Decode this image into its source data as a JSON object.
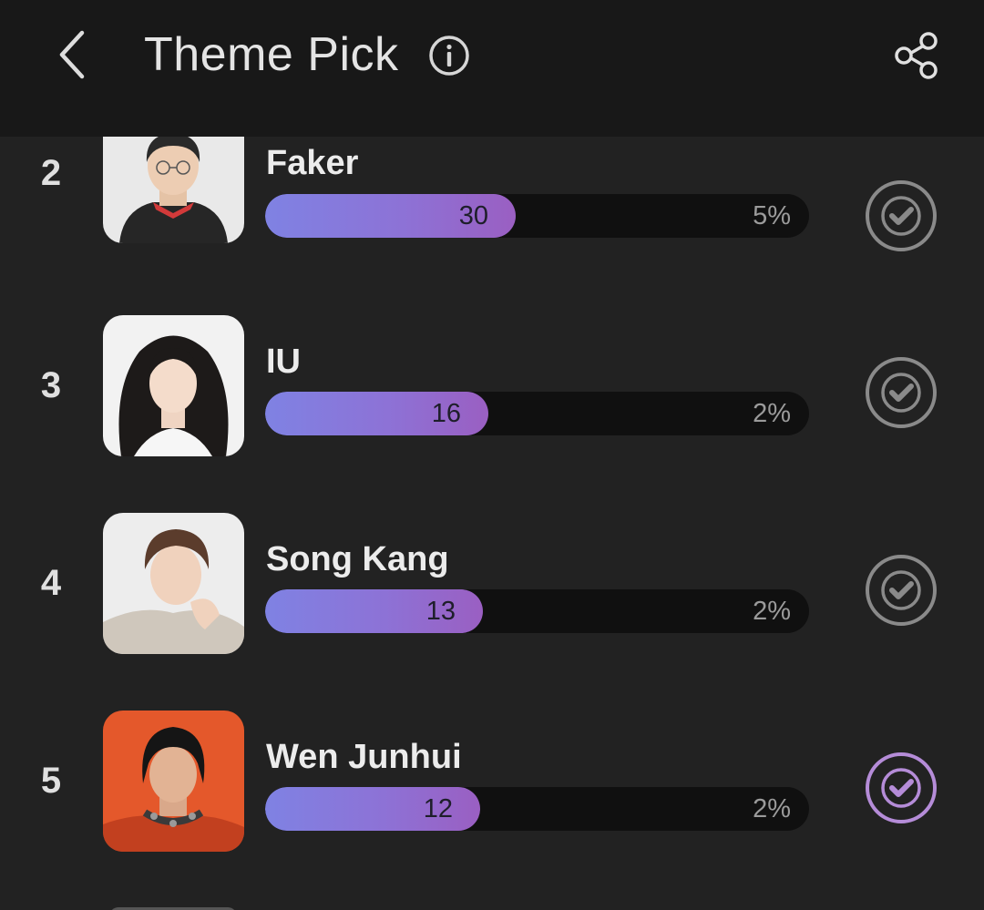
{
  "header": {
    "title": "Theme Pick"
  },
  "icons": {
    "back": "chevron-left-icon",
    "info": "info-icon",
    "share": "share-icon",
    "vote": "check-circle-icon"
  },
  "colors": {
    "background": "#222222",
    "header": "#181818",
    "bar_track": "#101010",
    "bar_gradient_start": "#7f82e3",
    "bar_gradient_end": "#9a5fc2",
    "vote_default": "#8a8a8a",
    "vote_selected": "#b58cd8"
  },
  "candidates": [
    {
      "rank": "2",
      "name": "Faker",
      "votes": "30",
      "percent": "5%",
      "share": 0.46,
      "selected": false
    },
    {
      "rank": "3",
      "name": "IU",
      "votes": "16",
      "percent": "2%",
      "share": 0.41,
      "selected": false
    },
    {
      "rank": "4",
      "name": "Song Kang",
      "votes": "13",
      "percent": "2%",
      "share": 0.4,
      "selected": false
    },
    {
      "rank": "5",
      "name": "Wen Junhui",
      "votes": "12",
      "percent": "2%",
      "share": 0.395,
      "selected": true
    }
  ]
}
